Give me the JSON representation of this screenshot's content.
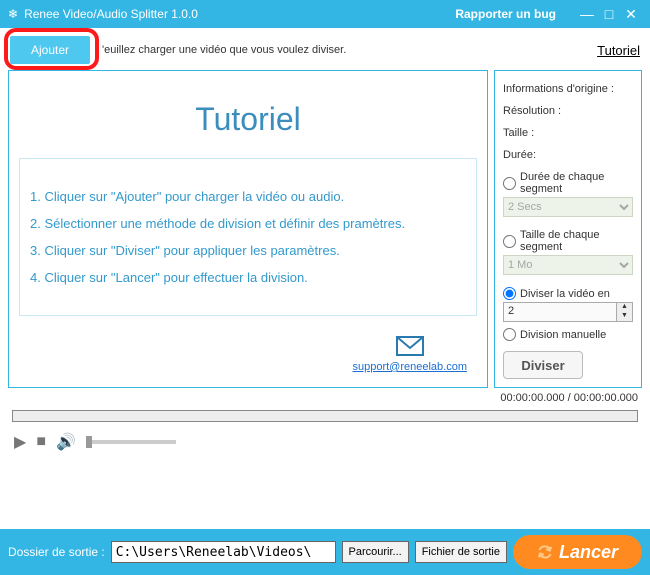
{
  "titlebar": {
    "icon": "❄",
    "title": "Renee Video/Audio Splitter 1.0.0",
    "bug": "Rapporter un bug"
  },
  "toolbar": {
    "add": "Ajouter",
    "instr": "'euillez charger une vidéo que vous voulez diviser.",
    "tutorial": "Tutoriel"
  },
  "tutorial": {
    "heading": "Tutoriel",
    "steps": [
      "1. Cliquer sur \"Ajouter\" pour charger la vidéo ou audio.",
      "2. Sélectionner une méthode de division et définir des pramètres.",
      "3. Cliquer sur \"Diviser\" pour appliquer les paramètres.",
      "4. Cliquer sur \"Lancer\" pour effectuer la division."
    ],
    "support": "support@reneelab.com"
  },
  "info": {
    "header": "Informations d'origine :",
    "resolution_label": "Résolution :",
    "size_label": "Taille :",
    "duration_label": "Durée:",
    "opt_duration": "Durée de chaque segment",
    "opt_duration_val": "2 Secs",
    "opt_size": "Taille de chaque segment",
    "opt_size_val": "1 Mo",
    "opt_split": "Diviser la vidéo en",
    "opt_split_val": "2",
    "opt_manual": "Division manuelle",
    "divide_btn": "Diviser"
  },
  "time": "00:00:00.000 / 00:00:00.000",
  "footer": {
    "label": "Dossier de sortie :",
    "path": "C:\\Users\\Reneelab\\Videos\\",
    "browse": "Parcourir...",
    "open": "Fichier de sortie",
    "launch": "Lancer"
  }
}
